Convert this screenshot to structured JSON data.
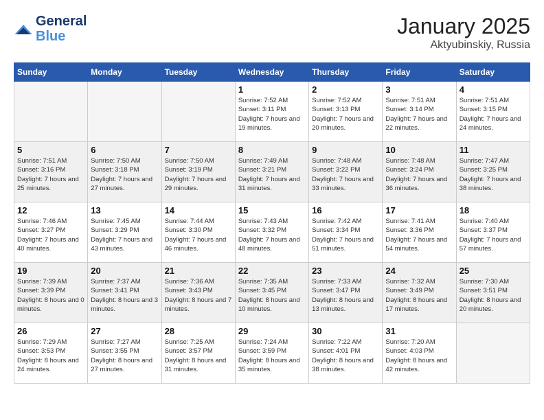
{
  "header": {
    "logo_line1": "General",
    "logo_line2": "Blue",
    "month": "January 2025",
    "location": "Aktyubinskiy, Russia"
  },
  "weekdays": [
    "Sunday",
    "Monday",
    "Tuesday",
    "Wednesday",
    "Thursday",
    "Friday",
    "Saturday"
  ],
  "weeks": [
    {
      "shaded": false,
      "days": [
        {
          "num": "",
          "empty": true
        },
        {
          "num": "",
          "empty": true
        },
        {
          "num": "",
          "empty": true
        },
        {
          "num": "1",
          "sunrise": "7:52 AM",
          "sunset": "3:11 PM",
          "daylight": "7 hours and 19 minutes."
        },
        {
          "num": "2",
          "sunrise": "7:52 AM",
          "sunset": "3:13 PM",
          "daylight": "7 hours and 20 minutes."
        },
        {
          "num": "3",
          "sunrise": "7:51 AM",
          "sunset": "3:14 PM",
          "daylight": "7 hours and 22 minutes."
        },
        {
          "num": "4",
          "sunrise": "7:51 AM",
          "sunset": "3:15 PM",
          "daylight": "7 hours and 24 minutes."
        }
      ]
    },
    {
      "shaded": true,
      "days": [
        {
          "num": "5",
          "sunrise": "7:51 AM",
          "sunset": "3:16 PM",
          "daylight": "7 hours and 25 minutes."
        },
        {
          "num": "6",
          "sunrise": "7:50 AM",
          "sunset": "3:18 PM",
          "daylight": "7 hours and 27 minutes."
        },
        {
          "num": "7",
          "sunrise": "7:50 AM",
          "sunset": "3:19 PM",
          "daylight": "7 hours and 29 minutes."
        },
        {
          "num": "8",
          "sunrise": "7:49 AM",
          "sunset": "3:21 PM",
          "daylight": "7 hours and 31 minutes."
        },
        {
          "num": "9",
          "sunrise": "7:48 AM",
          "sunset": "3:22 PM",
          "daylight": "7 hours and 33 minutes."
        },
        {
          "num": "10",
          "sunrise": "7:48 AM",
          "sunset": "3:24 PM",
          "daylight": "7 hours and 36 minutes."
        },
        {
          "num": "11",
          "sunrise": "7:47 AM",
          "sunset": "3:25 PM",
          "daylight": "7 hours and 38 minutes."
        }
      ]
    },
    {
      "shaded": false,
      "days": [
        {
          "num": "12",
          "sunrise": "7:46 AM",
          "sunset": "3:27 PM",
          "daylight": "7 hours and 40 minutes."
        },
        {
          "num": "13",
          "sunrise": "7:45 AM",
          "sunset": "3:29 PM",
          "daylight": "7 hours and 43 minutes."
        },
        {
          "num": "14",
          "sunrise": "7:44 AM",
          "sunset": "3:30 PM",
          "daylight": "7 hours and 46 minutes."
        },
        {
          "num": "15",
          "sunrise": "7:43 AM",
          "sunset": "3:32 PM",
          "daylight": "7 hours and 48 minutes."
        },
        {
          "num": "16",
          "sunrise": "7:42 AM",
          "sunset": "3:34 PM",
          "daylight": "7 hours and 51 minutes."
        },
        {
          "num": "17",
          "sunrise": "7:41 AM",
          "sunset": "3:36 PM",
          "daylight": "7 hours and 54 minutes."
        },
        {
          "num": "18",
          "sunrise": "7:40 AM",
          "sunset": "3:37 PM",
          "daylight": "7 hours and 57 minutes."
        }
      ]
    },
    {
      "shaded": true,
      "days": [
        {
          "num": "19",
          "sunrise": "7:39 AM",
          "sunset": "3:39 PM",
          "daylight": "8 hours and 0 minutes."
        },
        {
          "num": "20",
          "sunrise": "7:37 AM",
          "sunset": "3:41 PM",
          "daylight": "8 hours and 3 minutes."
        },
        {
          "num": "21",
          "sunrise": "7:36 AM",
          "sunset": "3:43 PM",
          "daylight": "8 hours and 7 minutes."
        },
        {
          "num": "22",
          "sunrise": "7:35 AM",
          "sunset": "3:45 PM",
          "daylight": "8 hours and 10 minutes."
        },
        {
          "num": "23",
          "sunrise": "7:33 AM",
          "sunset": "3:47 PM",
          "daylight": "8 hours and 13 minutes."
        },
        {
          "num": "24",
          "sunrise": "7:32 AM",
          "sunset": "3:49 PM",
          "daylight": "8 hours and 17 minutes."
        },
        {
          "num": "25",
          "sunrise": "7:30 AM",
          "sunset": "3:51 PM",
          "daylight": "8 hours and 20 minutes."
        }
      ]
    },
    {
      "shaded": false,
      "days": [
        {
          "num": "26",
          "sunrise": "7:29 AM",
          "sunset": "3:53 PM",
          "daylight": "8 hours and 24 minutes."
        },
        {
          "num": "27",
          "sunrise": "7:27 AM",
          "sunset": "3:55 PM",
          "daylight": "8 hours and 27 minutes."
        },
        {
          "num": "28",
          "sunrise": "7:25 AM",
          "sunset": "3:57 PM",
          "daylight": "8 hours and 31 minutes."
        },
        {
          "num": "29",
          "sunrise": "7:24 AM",
          "sunset": "3:59 PM",
          "daylight": "8 hours and 35 minutes."
        },
        {
          "num": "30",
          "sunrise": "7:22 AM",
          "sunset": "4:01 PM",
          "daylight": "8 hours and 38 minutes."
        },
        {
          "num": "31",
          "sunrise": "7:20 AM",
          "sunset": "4:03 PM",
          "daylight": "8 hours and 42 minutes."
        },
        {
          "num": "",
          "empty": true
        }
      ]
    }
  ]
}
